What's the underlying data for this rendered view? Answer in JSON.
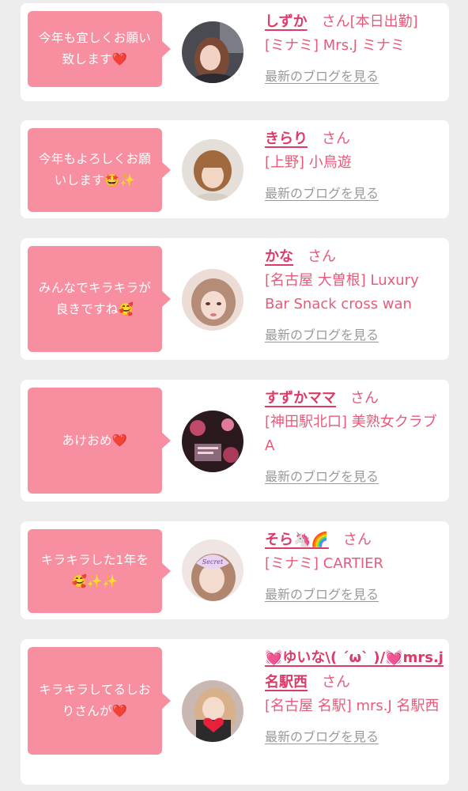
{
  "entries": [
    {
      "message": "今年も宜しくお願い致します❤️",
      "name": "しずか",
      "honorific": "さん",
      "status": "[本日出勤]",
      "shop": "[ミナミ] Mrs.J ミナミ",
      "blog_link": "最新のブログを見る",
      "avatar_icon": "woman-photo"
    },
    {
      "message": "今年もよろしくお願いします🤩✨",
      "name": "きらり",
      "honorific": "さん",
      "status": "",
      "shop": "[上野] 小鳥遊",
      "blog_link": "最新のブログを見る",
      "avatar_icon": "woman-photo"
    },
    {
      "message": "みんなでキラキラが良きですね🥰",
      "name": "かな",
      "honorific": "さん",
      "status": "",
      "shop": "[名古屋 大曽根] Luxury Bar Snack cross wan",
      "blog_link": "最新のブログを見る",
      "avatar_icon": "woman-photo"
    },
    {
      "message": "あけおめ❤️",
      "name": "すずかママ",
      "honorific": "さん",
      "status": "",
      "shop": "[神田駅北口] 美熟女クラブA",
      "blog_link": "最新のブログを見る",
      "avatar_icon": "flyer-photo"
    },
    {
      "message": "キラキラした1年を🥰✨✨",
      "name": "そら🦄🌈",
      "honorific": "さん",
      "status": "",
      "shop": "[ミナミ] CARTIER",
      "blog_link": "最新のブログを見る",
      "avatar_icon": "woman-photo-secret-sticker"
    },
    {
      "message": "キラキラしてるしおりさんが❤️",
      "name": "💓ゆいな\\( ´ω` )/💓mrs.j名駅西",
      "honorific": "さん",
      "status": "",
      "shop": "[名古屋 名駅] mrs.J 名駅西",
      "blog_link": "最新のブログを見る",
      "avatar_icon": "woman-photo-heart-sticker"
    }
  ],
  "colors": {
    "background": "#ededed",
    "card": "#ffffff",
    "bubble": "#f88fa0",
    "name": "#dc3b67",
    "text_pink": "#e85a7a",
    "link_gray": "#999999"
  }
}
